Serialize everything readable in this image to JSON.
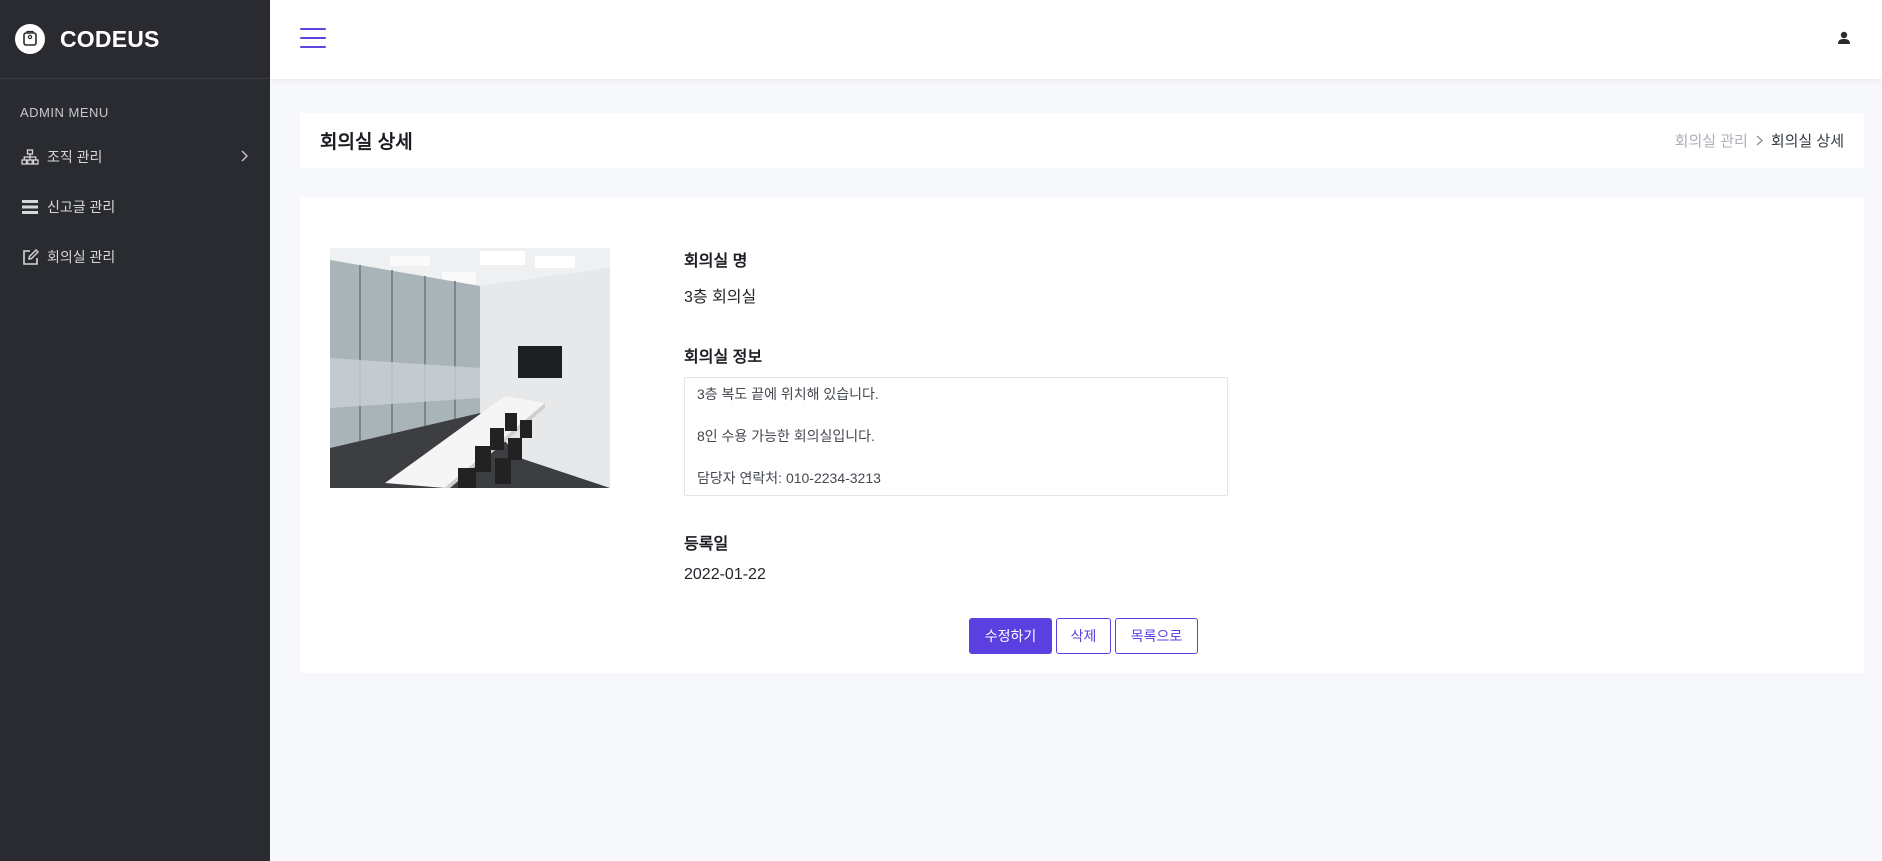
{
  "sidebar": {
    "brand": "CODEUS",
    "menu_title": "ADMIN MENU",
    "items": [
      {
        "label": "조직 관리",
        "icon": "sitemap-icon",
        "has_submenu": true
      },
      {
        "label": "신고글 관리",
        "icon": "list-icon",
        "has_submenu": false
      },
      {
        "label": "회의실 관리",
        "icon": "edit-icon",
        "has_submenu": false
      }
    ]
  },
  "header": {
    "menu_icon": "hamburger-icon",
    "user_icon": "user-icon"
  },
  "page": {
    "title": "회의실 상세",
    "breadcrumb": {
      "parent": "회의실 관리",
      "separator": ">",
      "current": "회의실 상세"
    }
  },
  "room": {
    "name_label": "회의실 명",
    "name": "3층 회의실",
    "info_label": "회의실 정보",
    "info_lines": [
      "3층 복도 끝에 위치해 있습니다.",
      "8인 수용 가능한 회의실입니다.",
      "담당자 연락처: 010-2234-3213"
    ],
    "date_label": "등록일",
    "date": "2022-01-22"
  },
  "actions": {
    "edit": "수정하기",
    "delete": "삭제",
    "list": "목록으로"
  },
  "colors": {
    "accent": "#5b3fe0",
    "sidebar_bg": "#2a2b31",
    "page_bg": "#f7f8fc"
  }
}
